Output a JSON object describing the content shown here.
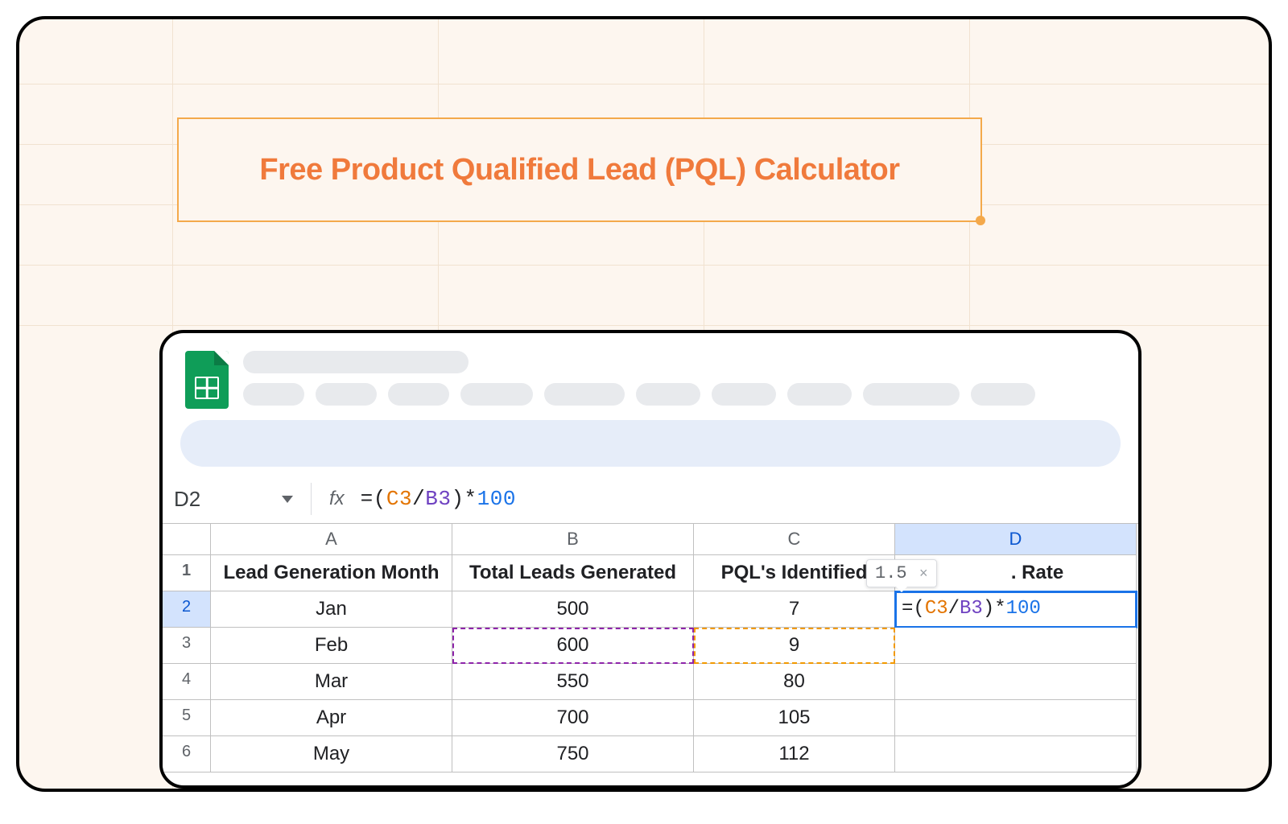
{
  "banner": {
    "title": "Free Product Qualified Lead (PQL) Calculator"
  },
  "formula_bar": {
    "cell_ref": "D2",
    "formula_display": "=(C3/B3)*100",
    "c3": "C3",
    "b3": "B3",
    "hundred": "100"
  },
  "columns": {
    "A": "A",
    "B": "B",
    "C": "C",
    "D": "D"
  },
  "headers": {
    "A": "Lead Generation Month",
    "B": "Total Leads Generated",
    "C": "PQL's Identified",
    "D": ". Rate"
  },
  "tooltip": {
    "value": "1.5"
  },
  "cell_formula": {
    "eq": "=",
    "open": "(",
    "c3": "C3",
    "slash": "/",
    "b3": "B3",
    "close": ")",
    "star": "*",
    "hundred": "100"
  },
  "rows": [
    {
      "n": "1"
    },
    {
      "n": "2",
      "A": "Jan",
      "B": "500",
      "C": "7"
    },
    {
      "n": "3",
      "A": "Feb",
      "B": "600",
      "C": "9"
    },
    {
      "n": "4",
      "A": "Mar",
      "B": "550",
      "C": "80"
    },
    {
      "n": "5",
      "A": "Apr",
      "B": "700",
      "C": "105"
    },
    {
      "n": "6",
      "A": "May",
      "B": "750",
      "C": "112"
    }
  ],
  "rownums": {
    "r1": "1",
    "r2": "2",
    "r3": "3",
    "r4": "4",
    "r5": "5",
    "r6": "6"
  }
}
